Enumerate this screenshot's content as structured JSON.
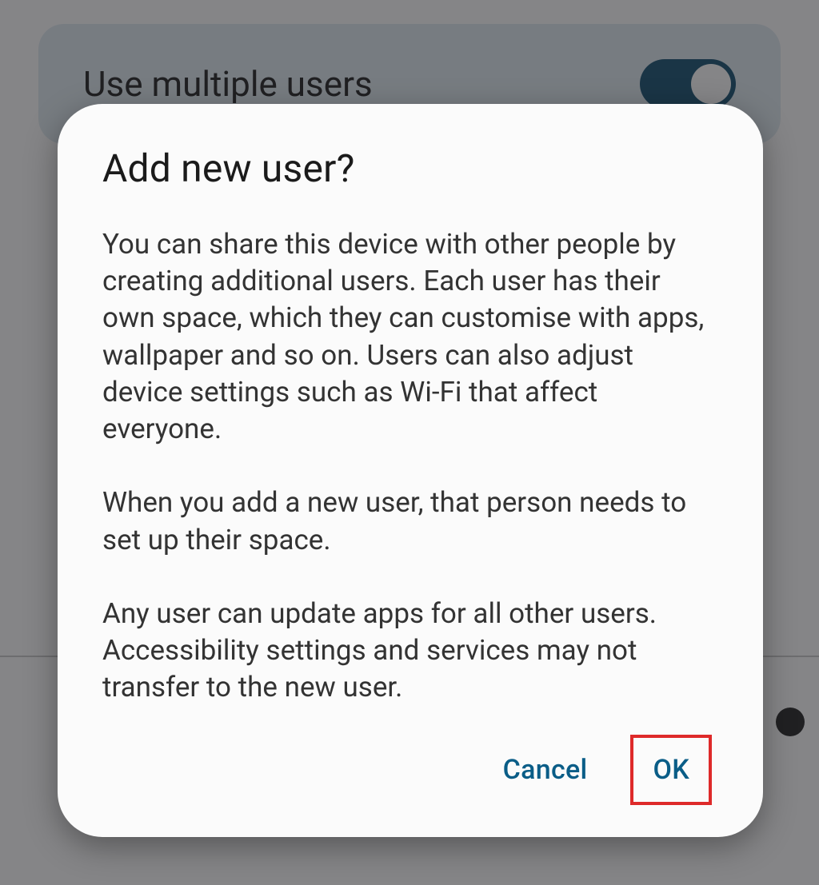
{
  "background": {
    "setting_title": "Use multiple users"
  },
  "dialog": {
    "title": "Add new user?",
    "body": "You can share this device with other people by creating additional users. Each user has their own space, which they can customise with apps, wallpaper and so on. Users can also adjust device settings such as Wi-Fi that affect everyone.\n\nWhen you add a new user, that person needs to set up their space.\n\nAny user can update apps for all other users. Accessibility settings and services may not transfer to the new user.",
    "cancel_label": "Cancel",
    "ok_label": "OK"
  }
}
